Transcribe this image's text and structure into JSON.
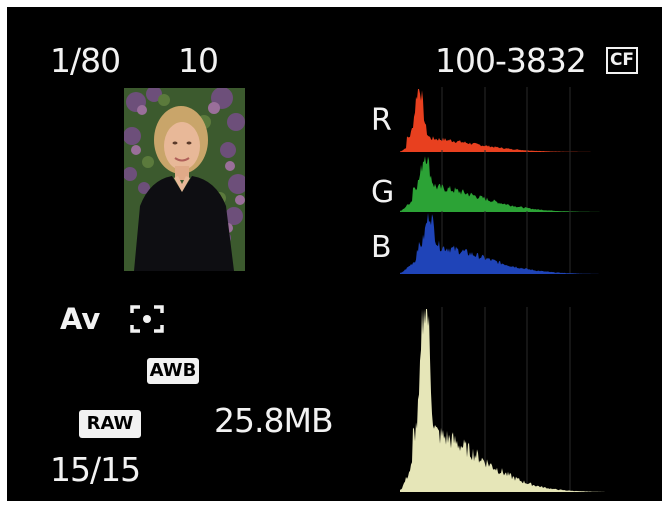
{
  "shooting_info": {
    "shutter_speed": "1/80",
    "aperture": "10",
    "folder_file_number": "100-3832",
    "card_icon_text": "CF",
    "shooting_mode": "Av",
    "metering_icon": "spot-metering-icon",
    "white_balance": "AWB",
    "image_quality": "RAW",
    "file_size": "25.8MB",
    "playback_number": "15/15"
  },
  "thumbnail": {
    "icon": "portrait-photo-thumbnail"
  },
  "histogram": {
    "rgb_channels": [
      {
        "label": "R",
        "color": "#e8401f"
      },
      {
        "label": "G",
        "color": "#2ca336"
      },
      {
        "label": "B",
        "color": "#1f44b8"
      }
    ],
    "brightness_color": "#e6e6b8"
  }
}
